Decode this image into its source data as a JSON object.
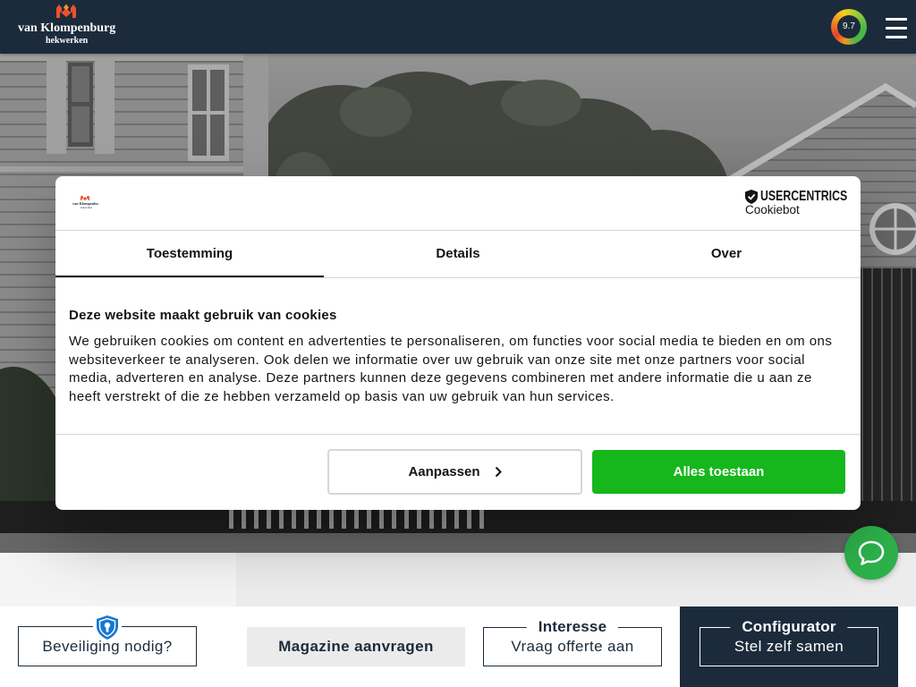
{
  "header": {
    "logo": {
      "name": "van Klompenburg",
      "tagline": "hekwerken",
      "mark_icon": "fence-logo-icon"
    },
    "rating": {
      "score": "9.7"
    },
    "menu_icon": "hamburger-menu-icon"
  },
  "cookie_dialog": {
    "provider": {
      "brand": "USERCENTRICS",
      "product": "Cookiebot",
      "icon": "usercentrics-shield-icon"
    },
    "tabs": [
      {
        "label": "Toestemming",
        "active": true
      },
      {
        "label": "Details",
        "active": false
      },
      {
        "label": "Over",
        "active": false
      }
    ],
    "title": "Deze website maakt gebruik van cookies",
    "body": "We gebruiken cookies om content en advertenties te personaliseren, om functies voor social media te bieden en om ons websiteverkeer te analyseren. Ook delen we informatie over uw gebruik van onze site met onze partners voor social media, adverteren en analyse. Deze partners kunnen deze gegevens combineren met andere informatie die u aan ze heeft verstrekt of die ze hebben verzameld op basis van uw gebruik van hun services.",
    "buttons": {
      "customize": "Aanpassen",
      "customize_icon": "chevron-right-icon",
      "allow_all": "Alles toestaan"
    }
  },
  "chat": {
    "icon": "chat-bubble-icon"
  },
  "bottom_bar": {
    "security": {
      "label": "Beveiliging nodig?",
      "icon": "shield-lock-icon"
    },
    "magazine": {
      "label": "Magazine aanvragen"
    },
    "quote": {
      "tag": "Interesse",
      "label": "Vraag offerte aan"
    },
    "configurator": {
      "tag": "Configurator",
      "label": "Stel zelf samen"
    }
  },
  "colors": {
    "brand_navy": "#1c2b3b",
    "accept_green": "#16b71d",
    "chat_green": "#2db24b",
    "shield_blue": "#1877d1",
    "logo_orange": "#e9532b"
  }
}
